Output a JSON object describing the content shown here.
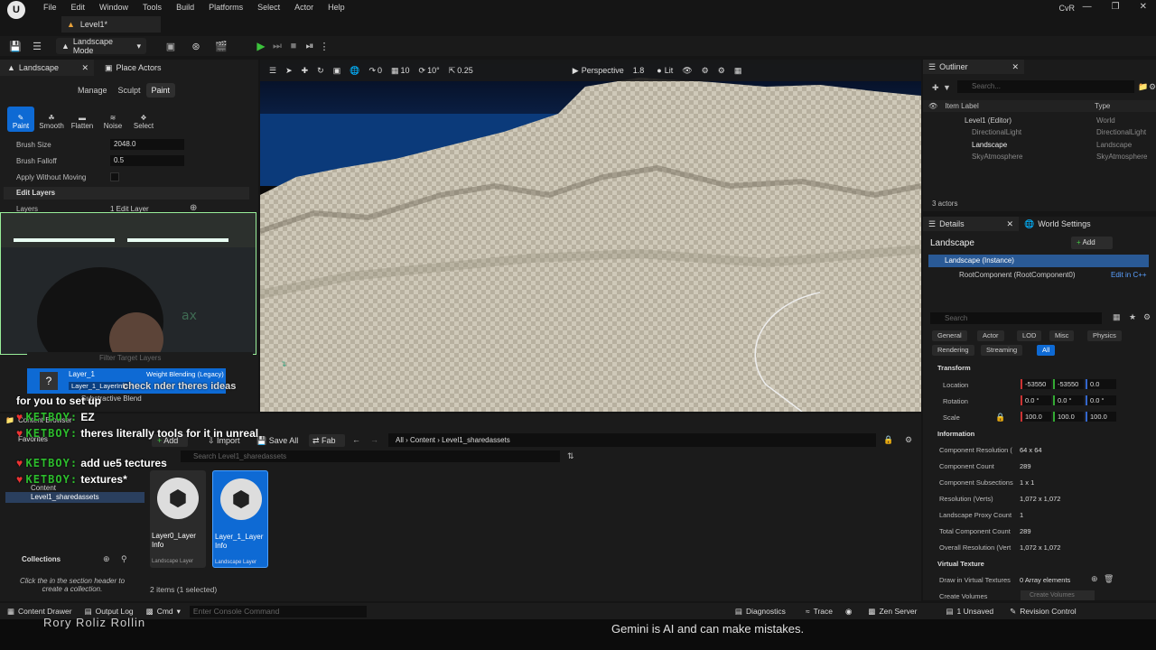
{
  "menubar": {
    "items": [
      "File",
      "Edit",
      "Window",
      "Tools",
      "Build",
      "Platforms",
      "Select",
      "Actor",
      "Help"
    ],
    "project": "CvR",
    "level_tab": "Level1*"
  },
  "toolbar": {
    "mode": "Landscape Mode"
  },
  "left_panel": {
    "tabs": [
      "Landscape",
      "Place Actors"
    ],
    "mode_tabs": [
      "Manage",
      "Sculpt",
      "Paint"
    ],
    "tools": [
      "Paint",
      "Smooth",
      "Flatten",
      "Noise",
      "Select"
    ],
    "brush_size_label": "Brush Size",
    "brush_size": "2048.0",
    "brush_falloff_label": "Brush Falloff",
    "brush_falloff": "0.5",
    "apply_without_moving": "Apply Without Moving",
    "edit_layers": "Edit Layers",
    "layers_label": "Layers",
    "layers_value": "1 Edit Layer",
    "filter_placeholder": "Filter Target Layers",
    "layer_name": "Layer_1",
    "layer_info": "Layer_1_LayerInfo",
    "layer_blend": "Weight Blending (Legacy)",
    "alpha_blend": "Substractive Blend"
  },
  "chat": {
    "line1": "for you to set up",
    "line2_prefix": "check",
    "line2_suffix": "nder theres ideas",
    "user": "KETBOY:",
    "msg1": "EZ",
    "msg2": "theres literally tools for it in unreal",
    "msg3": "add ue5 tectures",
    "msg3b": "textures*"
  },
  "viewport": {
    "perspective": "Perspective",
    "lit": "Lit",
    "fov": "1.8",
    "snap_grid": "10",
    "snap_rot": "10°",
    "snap_scale": "0.25",
    "zero": "0"
  },
  "outliner": {
    "title": "Outliner",
    "search_placeholder": "Search...",
    "col_label": "Item Label",
    "col_type": "Type",
    "items": [
      {
        "label": "Level1 (Editor)",
        "type": "World"
      },
      {
        "label": "DirectionalLight",
        "type": "DirectionalLight"
      },
      {
        "label": "Landscape",
        "type": "Landscape"
      },
      {
        "label": "SkyAtmosphere",
        "type": "SkyAtmosphere"
      }
    ],
    "count": "3 actors"
  },
  "details": {
    "tabs": [
      "Details",
      "World Settings"
    ],
    "object": "Landscape",
    "add": "Add",
    "instance": "Landscape (Instance)",
    "root": "RootComponent (RootComponent0)",
    "edit_cpp": "Edit in C++",
    "search_placeholder": "Search",
    "categories": [
      "General",
      "Actor",
      "LOD",
      "Misc",
      "Physics",
      "Rendering",
      "Streaming",
      "All"
    ],
    "transform": "Transform",
    "location_label": "Location",
    "location": [
      "-53550",
      "-53550",
      "0.0"
    ],
    "rotation_label": "Rotation",
    "rotation": [
      "0.0 °",
      "0.0 °",
      "0.0 °"
    ],
    "scale_label": "Scale",
    "scale": [
      "100.0",
      "100.0",
      "100.0"
    ],
    "information": "Information",
    "info": [
      {
        "k": "Component Resolution (",
        "v": "64 x 64"
      },
      {
        "k": "Component Count",
        "v": "289"
      },
      {
        "k": "Component Subsections",
        "v": "1 x 1"
      },
      {
        "k": "Resolution (Verts)",
        "v": "1,072 x 1,072"
      },
      {
        "k": "Landscape Proxy Count",
        "v": "1"
      },
      {
        "k": "Total Component Count",
        "v": "289"
      },
      {
        "k": "Overall Resolution (Vert",
        "v": "1,072 x 1,072"
      }
    ],
    "virtual_texture": "Virtual Texture",
    "draw_vt": "Draw in Virtual Textures",
    "draw_vt_val": "0 Array elements",
    "create_volumes": "Create Volumes",
    "create_volumes_btn": "Create Volumes"
  },
  "content": {
    "title": "Content Browser",
    "add": "Add",
    "import": "Import",
    "save_all": "Save All",
    "fab": "Fab",
    "path": [
      "All",
      "Content",
      "Level1_sharedassets"
    ],
    "search_placeholder": "Search Level1_sharedassets",
    "favorites": "Favorites",
    "tree_content": "Content",
    "tree_folder": "Level1_sharedassets",
    "collections": "Collections",
    "collections_hint": "Click the   in the section header to create a collection.",
    "assets": [
      {
        "name": "Layer0_Layer Info",
        "type": "Landscape Layer"
      },
      {
        "name": "Layer_1_Layer Info",
        "type": "Landscape Layer"
      }
    ],
    "count": "2 items (1 selected)"
  },
  "status": {
    "content_drawer": "Content Drawer",
    "output_log": "Output Log",
    "cmd": "Cmd",
    "console_placeholder": "Enter Console Command",
    "diagnostics": "Diagnostics",
    "trace": "Trace",
    "zen": "Zen Server",
    "unsaved": "1 Unsaved",
    "revision": "Revision Control"
  },
  "overlay": {
    "gemini": "Gemini is AI and can make mistakes.",
    "names": "Rory   Roliz   Rollin"
  }
}
